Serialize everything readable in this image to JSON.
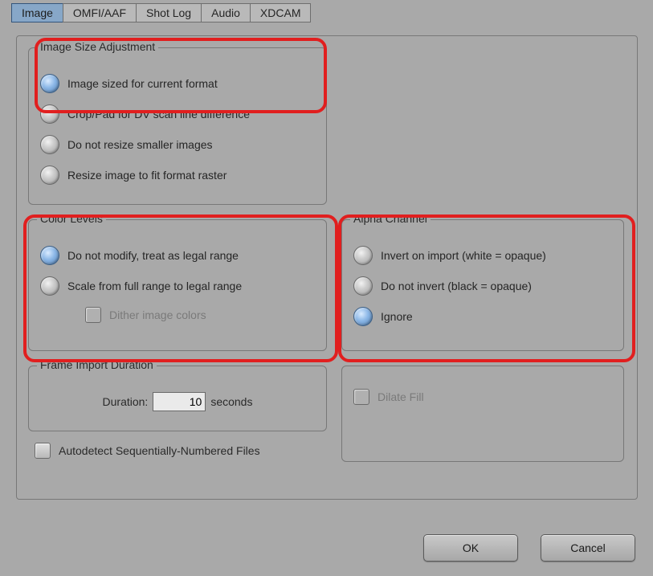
{
  "tabs": {
    "image": "Image",
    "omfi": "OMFI/AAF",
    "shotlog": "Shot Log",
    "audio": "Audio",
    "xdcam": "XDCAM"
  },
  "imageSize": {
    "legend": "Image Size Adjustment",
    "opt1": "Image sized for current format",
    "opt2": "Crop/Pad for DV scan line difference",
    "opt3": "Do not resize smaller images",
    "opt4": "Resize image to fit format raster"
  },
  "colorLevels": {
    "legend": "Color Levels",
    "opt1": "Do not modify, treat as legal range",
    "opt2": "Scale from full range to legal range",
    "dither": "Dither image colors"
  },
  "alpha": {
    "legend": "Alpha Channel",
    "opt1": "Invert on import (white = opaque)",
    "opt2": "Do not invert (black = opaque)",
    "opt3": "Ignore"
  },
  "duration": {
    "legend": "Frame Import Duration",
    "label": "Duration:",
    "value": "10",
    "unit": "seconds"
  },
  "dilate": "Dilate Fill",
  "autodetect": "Autodetect Sequentially-Numbered Files",
  "buttons": {
    "ok": "OK",
    "cancel": "Cancel"
  }
}
